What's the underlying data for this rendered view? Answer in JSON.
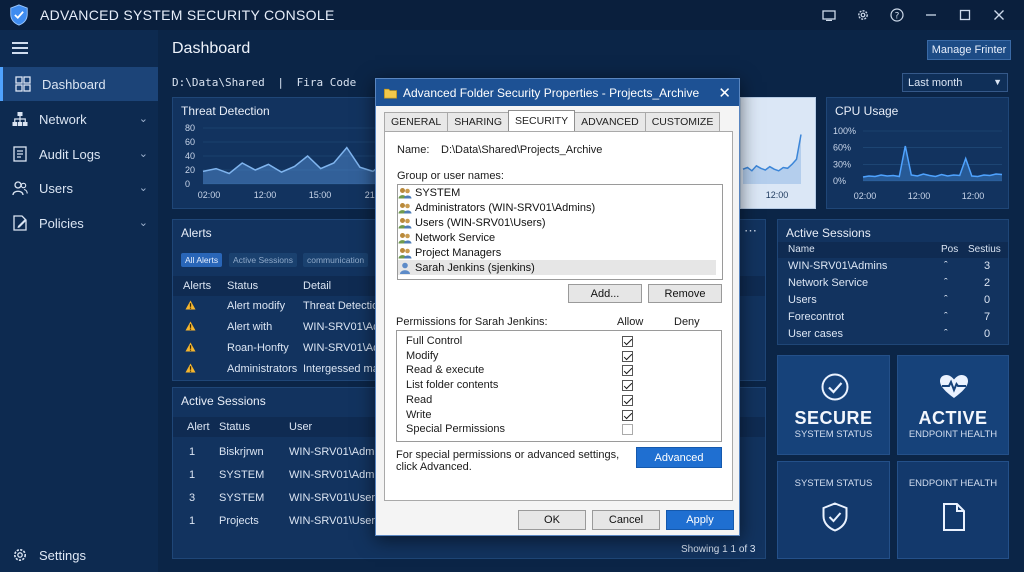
{
  "app": {
    "title": "ADVANCED SYSTEM SECURITY CONSOLE",
    "window_controls": [
      "screen-icon",
      "gear-icon",
      "help-icon",
      "minimize-icon",
      "maximize-icon",
      "close-icon"
    ]
  },
  "sidebar": {
    "items": [
      {
        "label": "Dashboard",
        "icon": "dashboard-icon",
        "active": true
      },
      {
        "label": "Network",
        "icon": "network-icon",
        "expandable": true
      },
      {
        "label": "Audit Logs",
        "icon": "audit-logs-icon",
        "expandable": true
      },
      {
        "label": "Users",
        "icon": "users-icon",
        "expandable": true
      },
      {
        "label": "Policies",
        "icon": "policies-icon",
        "expandable": true
      }
    ],
    "settings_label": "Settings"
  },
  "header": {
    "title": "Dashboard",
    "manage_button": "Manage Frinter",
    "path": "D:\\Data\\Shared",
    "path_sep": "|",
    "path_font": "Fira Code",
    "range": "Last month"
  },
  "threat_panel": {
    "title": "Threat Detection",
    "chart_data": {
      "type": "line",
      "y_ticks": [
        "80",
        "60",
        "40",
        "20",
        "0"
      ],
      "x_ticks": [
        "02:00",
        "12:00",
        "15:00",
        "21:00"
      ],
      "ylim": [
        0,
        80
      ],
      "values": [
        18,
        22,
        15,
        30,
        20,
        28,
        17,
        25,
        40,
        22,
        30,
        52,
        24,
        18,
        38,
        22,
        45,
        28,
        20,
        34,
        24,
        30,
        26,
        42,
        28,
        22,
        30
      ]
    }
  },
  "network_panel": {
    "x_tick": "12:00",
    "values": [
      18,
      20,
      16,
      22,
      19,
      17,
      21,
      18,
      16,
      20,
      19,
      24,
      30,
      60
    ]
  },
  "cpu_panel": {
    "title": "CPU Usage",
    "chart_data": {
      "type": "line",
      "y_ticks": [
        "100%",
        "60%",
        "30%",
        "0%"
      ],
      "x_ticks": [
        "02:00",
        "12:00",
        "12:00"
      ],
      "ylim": [
        0,
        100
      ],
      "values": [
        8,
        10,
        9,
        12,
        10,
        11,
        9,
        70,
        12,
        10,
        14,
        11,
        9,
        13,
        10,
        12,
        11,
        45,
        10,
        9,
        12,
        11,
        14,
        13
      ]
    }
  },
  "alerts_panel": {
    "title": "Alerts",
    "chips": [
      "All Alerts",
      "Active Sessions",
      "communication"
    ],
    "columns": [
      "Alerts",
      "Status",
      "Detail"
    ],
    "rows": [
      {
        "status": "Alert modify",
        "detail": "Threat Detection"
      },
      {
        "status": "Alert with",
        "detail": "WIN-SRV01\\Admin"
      },
      {
        "status": "Roan-Honfty",
        "detail": "WIN-SRV01\\Admin"
      },
      {
        "status": "Administrators",
        "detail": "Intergessed mat"
      }
    ]
  },
  "sessions_panel": {
    "title": "Active Sessions",
    "columns": [
      "Alert",
      "Status",
      "User"
    ],
    "rows": [
      {
        "alert": "1",
        "status": "Biskrjrwn",
        "user": "WIN-SRV01\\Admin"
      },
      {
        "alert": "1",
        "status": "SYSTEM",
        "user": "WIN-SRV01\\Admin"
      },
      {
        "alert": "3",
        "status": "SYSTEM",
        "user": "WIN-SRV01\\Users\\"
      },
      {
        "alert": "1",
        "status": "Projects",
        "user": "WIN-SRV01\\Users\\"
      }
    ],
    "footer": "Showing 1 1 of 3"
  },
  "right_sessions": {
    "title": "Active Sessions",
    "columns": [
      "Name",
      "Pos",
      "Sestius"
    ],
    "rows": [
      {
        "name": "WIN-SRV01\\Admins",
        "pos": "ˆ",
        "count": "3"
      },
      {
        "name": "Network Service",
        "pos": "ˆ",
        "count": "2"
      },
      {
        "name": "Users",
        "pos": "ˆ",
        "count": "0"
      },
      {
        "name": "Forecontrot",
        "pos": "ˆ",
        "count": "7"
      },
      {
        "name": "User cases",
        "pos": "ˆ",
        "count": "0"
      }
    ]
  },
  "tiles": [
    {
      "big": "SECURE",
      "small": "SYSTEM STATUS",
      "icon": "check-circle-icon"
    },
    {
      "big": "ACTIVE",
      "small": "ENDPOINT HEALTH",
      "icon": "heartbeat-icon"
    },
    {
      "small": "SYSTEM STATUS",
      "icon": "shield-check-icon"
    },
    {
      "small": "ENDPOINT HEALTH",
      "icon": "document-icon"
    }
  ],
  "dialog": {
    "title": "Advanced Folder Security Properties - Projects_Archive",
    "tabs": [
      "GENERAL",
      "SHARING",
      "SECURITY",
      "ADVANCED",
      "CUSTOMIZE"
    ],
    "selected_tab": "SECURITY",
    "name_label": "Name:",
    "name_value": "D:\\Data\\Shared\\Projects_Archive",
    "group_label": "Group or user names:",
    "groups": [
      "SYSTEM",
      "Administrators (WIN-SRV01\\Admins)",
      "Users (WIN-SRV01\\Users)",
      "Network Service",
      "Project Managers",
      "Sarah Jenkins (sjenkins)"
    ],
    "add_label": "Add...",
    "remove_label": "Remove",
    "perm_label": "Permissions for Sarah Jenkins:",
    "allow_label": "Allow",
    "deny_label": "Deny",
    "permissions": [
      {
        "name": "Full Control",
        "allow": true
      },
      {
        "name": "Modify",
        "allow": true
      },
      {
        "name": "Read & execute",
        "allow": true
      },
      {
        "name": "List folder contents",
        "allow": true
      },
      {
        "name": "Read",
        "allow": true
      },
      {
        "name": "Write",
        "allow": true
      },
      {
        "name": "Special Permissions",
        "allow": false
      }
    ],
    "special_text_1": "For special permissions or advanced settings,",
    "special_text_2": "click Advanced.",
    "advanced_label": "Advanced",
    "ok_label": "OK",
    "cancel_label": "Cancel",
    "apply_label": "Apply"
  }
}
